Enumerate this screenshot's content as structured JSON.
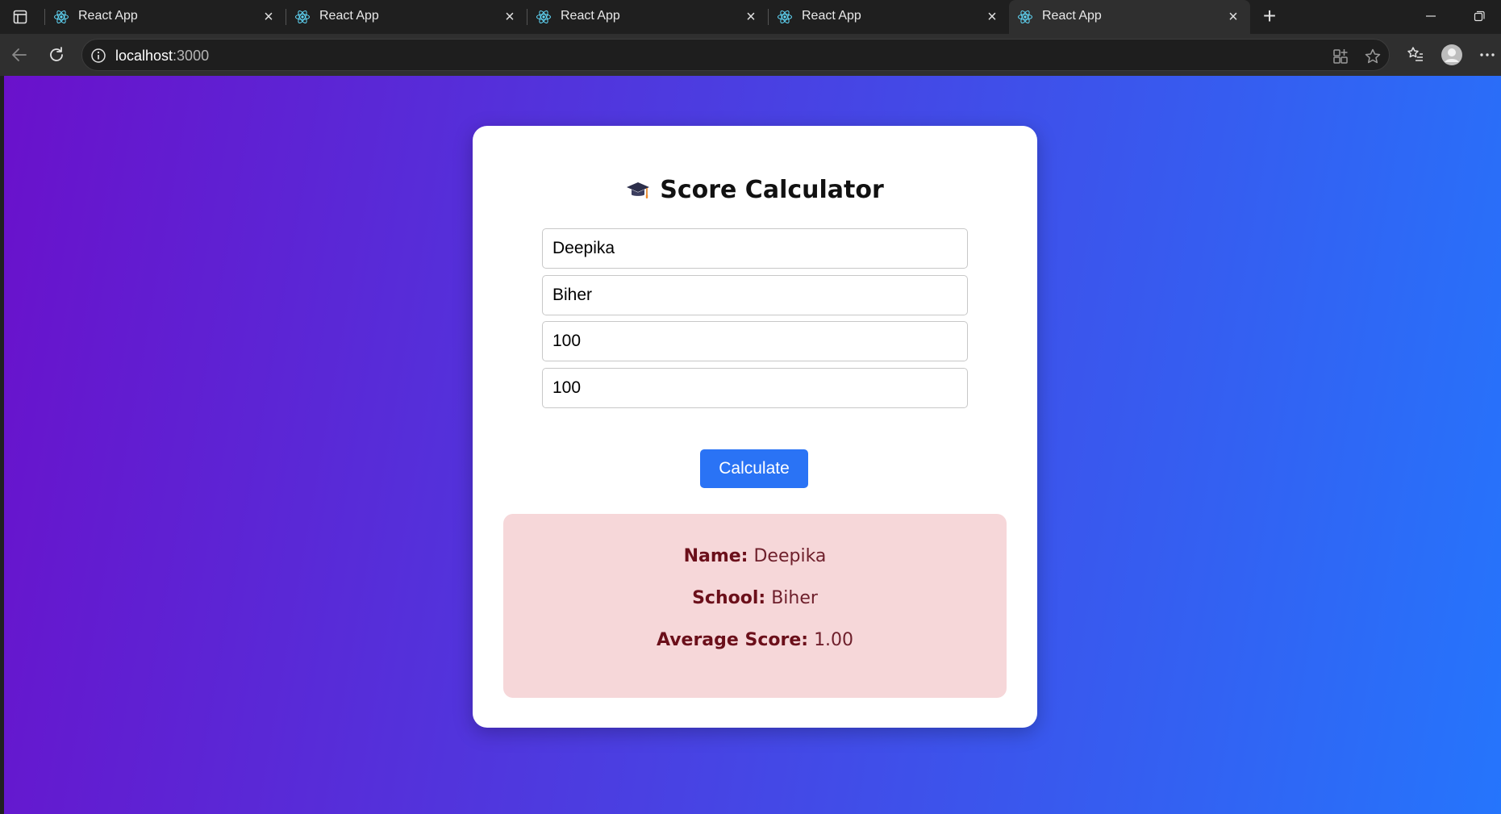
{
  "browser": {
    "tabs": [
      {
        "title": "React App",
        "active": false
      },
      {
        "title": "React App",
        "active": false
      },
      {
        "title": "React App",
        "active": false
      },
      {
        "title": "React App",
        "active": false
      },
      {
        "title": "React App",
        "active": true
      }
    ],
    "address": {
      "host": "localhost",
      "port": ":3000"
    }
  },
  "app": {
    "title": "Score Calculator",
    "title_icon": "graduation-cap-icon",
    "fields": {
      "name": "Deepika",
      "school": "Biher",
      "score1": "100",
      "score2": "100"
    },
    "calculate_label": "Calculate",
    "result": {
      "name_label": "Name:",
      "name_value": "Deepika",
      "school_label": "School:",
      "school_value": "Biher",
      "avg_label": "Average Score:",
      "avg_value": "1.00"
    }
  },
  "colors": {
    "gradient_start": "#6a11cb",
    "gradient_end": "#2575fc",
    "button": "#2a73f5",
    "result_bg": "#f6d7d9",
    "result_text": "#6b0f1a"
  }
}
